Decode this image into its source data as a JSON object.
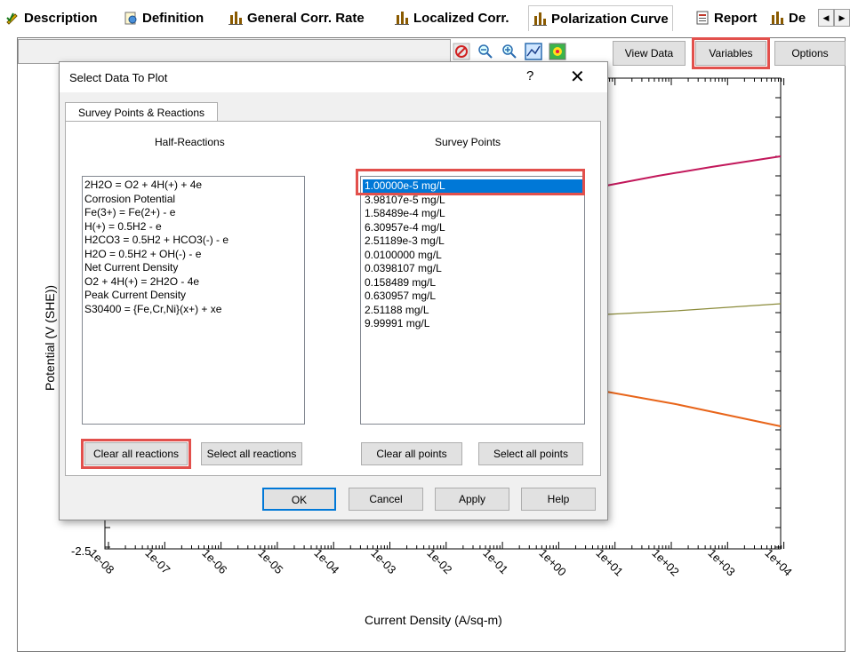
{
  "tabs": [
    {
      "label": "Description",
      "icon": "pencil-check-icon"
    },
    {
      "label": "Definition",
      "icon": "gear-doc-icon"
    },
    {
      "label": "General Corr. Rate",
      "icon": "bar-chart-icon"
    },
    {
      "label": "Localized Corr.",
      "icon": "bar-chart-icon"
    },
    {
      "label": "Polarization Curve",
      "icon": "bar-chart-icon"
    },
    {
      "label": "Report",
      "icon": "report-icon"
    },
    {
      "label": "De",
      "icon": "bar-chart-icon"
    }
  ],
  "toolbar": {
    "view_data": "View Data",
    "variables": "Variables",
    "options": "Options"
  },
  "dialog": {
    "title": "Select Data To Plot",
    "help_glyph": "?",
    "close_glyph": "✕",
    "tab_label": "Survey Points & Reactions",
    "reactions_header": "Half-Reactions",
    "points_header": "Survey Points",
    "reactions": [
      "2H2O = O2 + 4H(+) + 4e",
      "Corrosion Potential",
      "Fe(3+) = Fe(2+) - e",
      "H(+) = 0.5H2 - e",
      "H2CO3 = 0.5H2 + HCO3(-) - e",
      "H2O = 0.5H2 + OH(-) - e",
      "Net Current Density",
      "O2 + 4H(+) = 2H2O - 4e",
      "Peak Current Density",
      "S30400 = {Fe,Cr,Ni}(x+) + xe"
    ],
    "points": [
      "1.00000e-5 mg/L",
      "3.98107e-5 mg/L",
      "1.58489e-4 mg/L",
      "6.30957e-4 mg/L",
      "2.51189e-3 mg/L",
      "0.0100000 mg/L",
      "0.0398107 mg/L",
      "0.158489 mg/L",
      "0.630957 mg/L",
      "2.51188 mg/L",
      "9.99991 mg/L"
    ],
    "selected_point": "1.00000e-5 mg/L",
    "buttons": {
      "clear_reactions": "Clear all reactions",
      "select_reactions": "Select all reactions",
      "clear_points": "Clear all points",
      "select_points": "Select all points",
      "ok": "OK",
      "cancel": "Cancel",
      "apply": "Apply",
      "help": "Help"
    }
  },
  "plot": {
    "ylabel": "Potential (V (SHE))",
    "xlabel": "Current Density (A/sq-m)",
    "ytick_bottom": "-2.5",
    "xticks": [
      "1e-08",
      "1e-07",
      "1e-06",
      "1e-05",
      "1e-04",
      "1e-03",
      "1e-02",
      "1e-01",
      "1e+00",
      "1e+01",
      "1e+02",
      "1e+03",
      "1e+04"
    ],
    "line_colors": [
      "#c2185b",
      "#8b8b3a",
      "#e8651a"
    ]
  }
}
